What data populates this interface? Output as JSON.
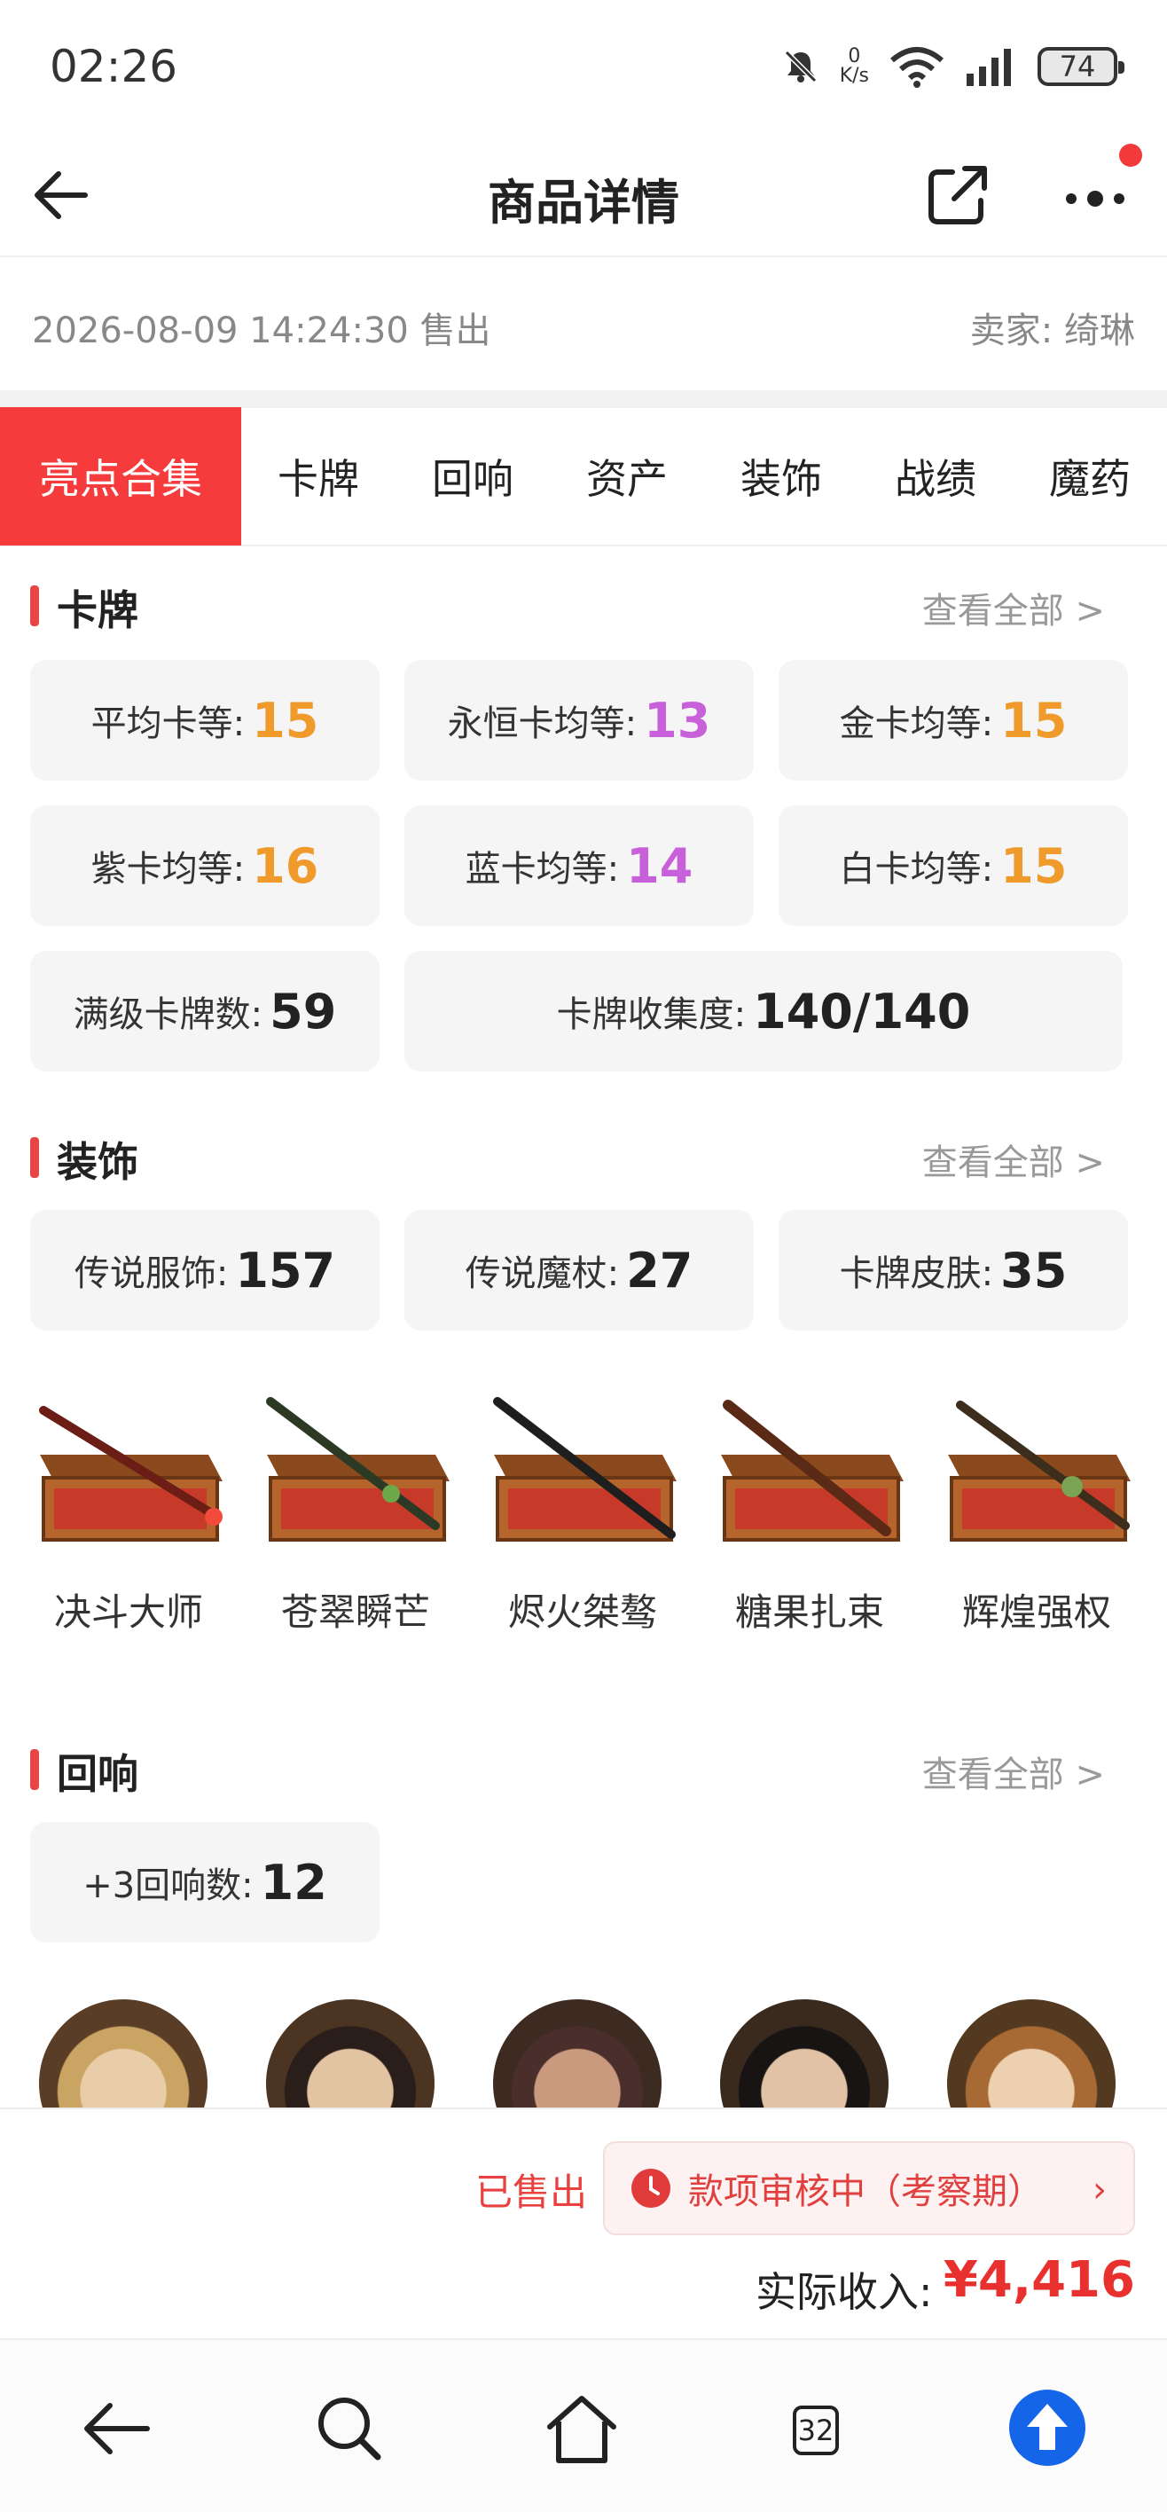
{
  "status_bar": {
    "time": "02:26",
    "net_speed_value": "0",
    "net_speed_unit": "K/s",
    "signal_label": "6",
    "battery": "74"
  },
  "header": {
    "title": "商品详情"
  },
  "sale_info": {
    "sold_time": "2026-08-09 14:24:30 售出",
    "seller": "卖家: 绮琳"
  },
  "tabs": [
    {
      "label": "亮点合集",
      "active": true
    },
    {
      "label": "卡牌",
      "active": false
    },
    {
      "label": "回响",
      "active": false
    },
    {
      "label": "资产",
      "active": false
    },
    {
      "label": "装饰",
      "active": false
    },
    {
      "label": "战绩",
      "active": false
    },
    {
      "label": "魔药",
      "active": false
    }
  ],
  "cards_section": {
    "title": "卡牌",
    "view_all": "查看全部 >",
    "stats": [
      {
        "label": "平均卡等:",
        "value": "15",
        "color": "#ef9a2a"
      },
      {
        "label": "永恒卡均等:",
        "value": "13",
        "color": "#c760d9"
      },
      {
        "label": "金卡均等:",
        "value": "15",
        "color": "#ef9a2a"
      },
      {
        "label": "紫卡均等:",
        "value": "16",
        "color": "#ef9a2a"
      },
      {
        "label": "蓝卡均等:",
        "value": "14",
        "color": "#c760d9"
      },
      {
        "label": "白卡均等:",
        "value": "15",
        "color": "#ef9a2a"
      },
      {
        "label": "满级卡牌数:",
        "value": "59",
        "color": "#222222"
      },
      {
        "label": "卡牌收集度:",
        "value": "140/140",
        "color": "#222222"
      }
    ]
  },
  "decor_section": {
    "title": "装饰",
    "view_all": "查看全部 >",
    "stats": [
      {
        "label": "传说服饰:",
        "value": "157"
      },
      {
        "label": "传说魔杖:",
        "value": "27"
      },
      {
        "label": "卡牌皮肤:",
        "value": "35"
      }
    ],
    "items": [
      {
        "name": "决斗大师",
        "icon": "wand-red-icon"
      },
      {
        "name": "苍翠瞬芒",
        "icon": "wand-green-icon"
      },
      {
        "name": "烬火桀骜",
        "icon": "wand-black-icon"
      },
      {
        "name": "糖果扎束",
        "icon": "wand-brown-icon"
      },
      {
        "name": "辉煌强权",
        "icon": "wand-gold-icon"
      }
    ]
  },
  "echo_section": {
    "title": "回响",
    "view_all": "查看全部 >",
    "stats": [
      {
        "label": "+3回响数:",
        "value": "12"
      }
    ],
    "avatars": [
      "avatar-1",
      "avatar-2",
      "avatar-3",
      "avatar-4",
      "avatar-5"
    ]
  },
  "sale_panel": {
    "status": "已售出",
    "review": "款项审核中（考察期）",
    "review_chevron": "›",
    "income_label": "实际收入:",
    "income_value": "¥4,416"
  },
  "navbar": {
    "tab_count": "32"
  },
  "colors": {
    "accent_red": "#f53b3b",
    "orange_value": "#ef9a2a",
    "purple_value": "#c760d9",
    "upload_blue": "#1565e8"
  }
}
